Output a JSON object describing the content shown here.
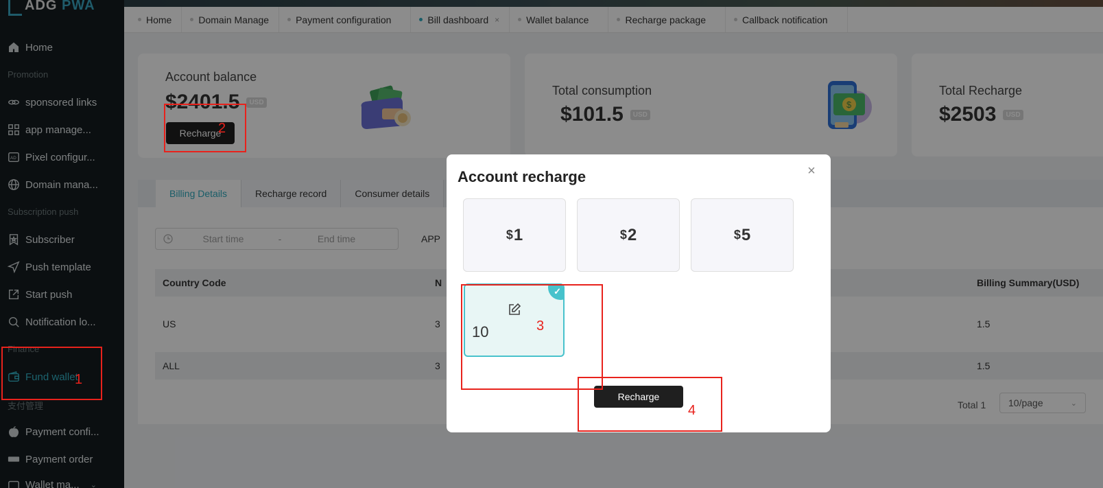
{
  "app": {
    "logo_text": "ADG",
    "logo_accent": "PWA"
  },
  "sidebar": {
    "home": "Home",
    "sections": {
      "promotion": "Promotion",
      "subscription": "Subscription push",
      "finance": "Finance",
      "payment_mgmt": "支付管理"
    },
    "items": [
      {
        "label": "sponsored links",
        "icon": "link-icon"
      },
      {
        "label": "app manage...",
        "icon": "grid-icon"
      },
      {
        "label": "Pixel configur...",
        "icon": "ad-icon"
      },
      {
        "label": "Domain mana...",
        "icon": "globe-icon"
      },
      {
        "label": "Subscriber",
        "icon": "bookmark-icon"
      },
      {
        "label": "Push template",
        "icon": "send-icon"
      },
      {
        "label": "Start push",
        "icon": "share-icon"
      },
      {
        "label": "Notification lo...",
        "icon": "search-icon"
      },
      {
        "label": "Fund wallet",
        "icon": "wallet-icon"
      },
      {
        "label": "Payment confi...",
        "icon": "apple-icon"
      },
      {
        "label": "Payment order",
        "icon": "paypal-icon"
      },
      {
        "label": "Wallet ma...",
        "icon": "wallet-icon"
      }
    ]
  },
  "tabs": [
    {
      "label": "Home"
    },
    {
      "label": "Domain Manage"
    },
    {
      "label": "Payment configuration"
    },
    {
      "label": "Bill dashboard",
      "active": true,
      "close": "×"
    },
    {
      "label": "Wallet balance"
    },
    {
      "label": "Recharge package"
    },
    {
      "label": "Callback notification"
    }
  ],
  "cards": {
    "balance": {
      "title": "Account balance",
      "amount": "$2401.5",
      "unit": "USD",
      "button": "Recharge"
    },
    "consumption": {
      "title": "Total consumption",
      "amount": "$101.5",
      "unit": "USD"
    },
    "recharge": {
      "title": "Total Recharge",
      "amount": "$2503",
      "unit": "USD"
    }
  },
  "billing": {
    "tabs": [
      "Billing Details",
      "Recharge record",
      "Consumer details"
    ],
    "filter": {
      "start": "Start time",
      "sep": "-",
      "end": "End time",
      "app_label": "APP"
    },
    "columns": {
      "country": "Country Code",
      "n": "N",
      "summary": "Billing Summary(USD)"
    },
    "rows": [
      {
        "country": "US",
        "n": "3",
        "summary": "1.5"
      },
      {
        "country": "ALL",
        "n": "3",
        "summary": "1.5"
      }
    ],
    "pager": {
      "total": "Total 1",
      "per_page": "10/page"
    }
  },
  "modal": {
    "title": "Account recharge",
    "close": "×",
    "options": [
      {
        "currency": "$",
        "value": "1"
      },
      {
        "currency": "$",
        "value": "2"
      },
      {
        "currency": "$",
        "value": "5"
      }
    ],
    "custom_value": "10",
    "check": "✓",
    "button": "Recharge"
  },
  "annotations": [
    "1",
    "2",
    "3",
    "4"
  ],
  "colors": {
    "accent": "#2fa9bd",
    "annotation": "#e8221c",
    "dark_button": "#1f1f1f"
  }
}
